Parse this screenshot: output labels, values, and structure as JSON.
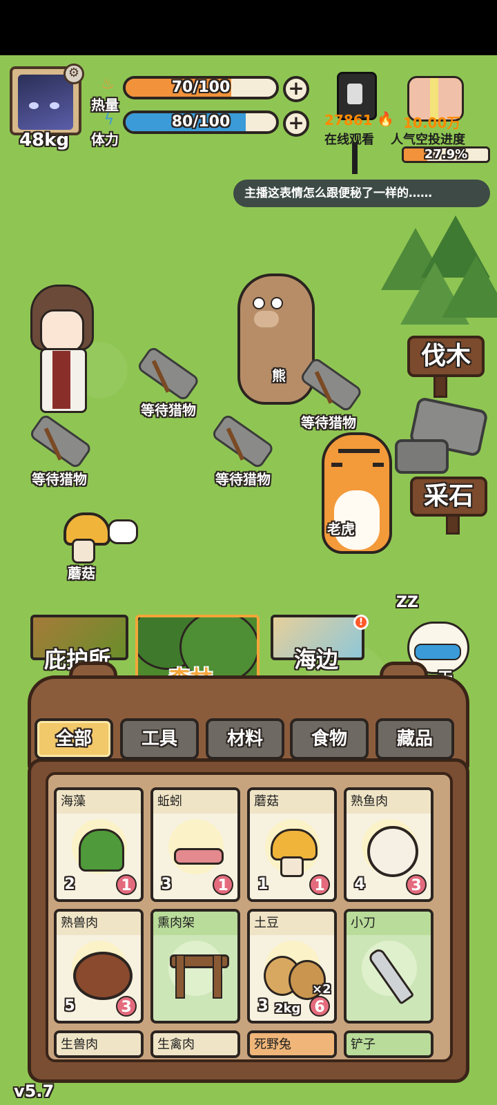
{
  "player": {
    "weight": "48kg",
    "heat_label": "热量",
    "heat_value": "70/100",
    "heat_fraction": 0.7,
    "stamina_label": "体力",
    "stamina_value": "80/100",
    "stamina_fraction": 0.8
  },
  "stream": {
    "viewers": "27861",
    "viewers_label": "在线观看",
    "airdrop_amount": "10.00万",
    "airdrop_label": "人气空投进度",
    "airdrop_progress": "27.9%",
    "airdrop_fraction": 0.279,
    "comment": "主播这表情怎么跟便秘了一样的……"
  },
  "scene": {
    "sign_wood": "伐木",
    "sign_stone": "采石",
    "bear_label": "熊",
    "tiger_label": "老虎",
    "mushroom_label": "蘑菇",
    "trap_labels": [
      "等待猎物",
      "等待猎物",
      "等待猎物",
      "等待猎物"
    ]
  },
  "locations": {
    "shelter": "庇护所",
    "forest": "森林",
    "seaside": "海边",
    "seaside_badge": "!",
    "next_day": "下一天",
    "sleep_z": "ZZ"
  },
  "inventory": {
    "categories": [
      "全部",
      "工具",
      "材料",
      "食物",
      "藏品"
    ],
    "active_category": "全部",
    "items": [
      {
        "name": "海藻",
        "cal": "2",
        "qty": "1"
      },
      {
        "name": "蚯蚓",
        "cal": "3",
        "qty": "1"
      },
      {
        "name": "蘑菇",
        "cal": "1",
        "qty": "1"
      },
      {
        "name": "熟鱼肉",
        "cal": "4",
        "qty": "3"
      },
      {
        "name": "熟兽肉",
        "cal": "5",
        "qty": "3"
      },
      {
        "name": "熏肉架",
        "cal": "",
        "qty": ""
      },
      {
        "name": "土豆",
        "cal": "3",
        "qty": "6",
        "weight": "2kg",
        "multiplier": "×2"
      },
      {
        "name": "小刀",
        "cal": "",
        "qty": ""
      },
      {
        "name": "生兽肉"
      },
      {
        "name": "生禽肉"
      },
      {
        "name": "死野兔"
      },
      {
        "name": "铲子"
      }
    ]
  },
  "version": "v5.7",
  "icons": {
    "settings": "gear-icon",
    "heat": "flame-icon",
    "stamina": "lightning-icon",
    "add": "plus-icon",
    "camera": "phone-camera-icon",
    "viewers_flame": "fire-icon",
    "gift": "gift-icon"
  },
  "colors": {
    "grass": "#8fc653",
    "heat_bar": "#f2923a",
    "stamina_bar": "#3a9bd8",
    "viewer_orange": "#ff8a00",
    "wood_brown": "#7c4a2d"
  }
}
